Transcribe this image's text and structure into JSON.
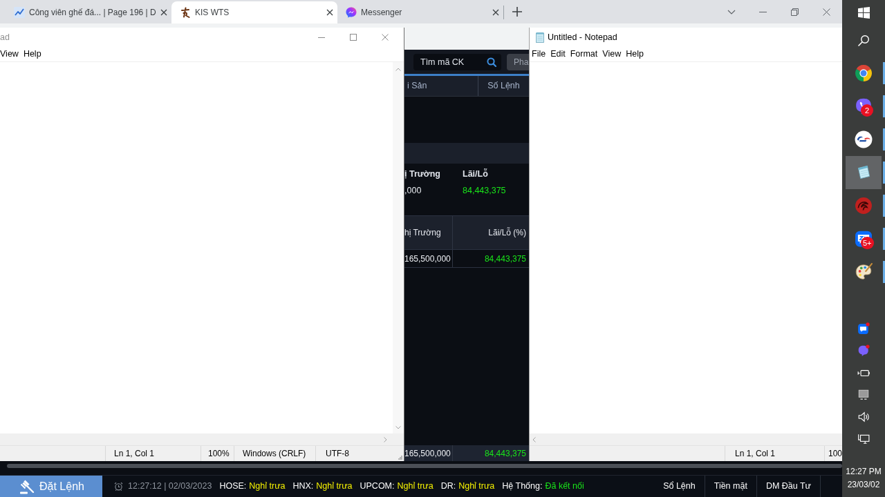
{
  "browser": {
    "tabs": [
      {
        "title": "Công viên ghế đá... | Page 196 | D",
        "selected": false
      },
      {
        "title": "KIS WTS",
        "selected": true
      },
      {
        "title": "Messenger",
        "selected": false
      }
    ]
  },
  "trading_app": {
    "search": {
      "placeholder": "Tìm mã CK"
    },
    "header_button": "Pha",
    "tabs": [
      {
        "label": "i Sản",
        "selected": false
      },
      {
        "label": "Số Lệnh",
        "selected": false
      }
    ],
    "summary": [
      {
        "label": "ị Trường",
        "value": ",000",
        "kind": "plain"
      },
      {
        "label": "Lãi/Lỗ",
        "value": "84,443,375",
        "kind": "gain"
      }
    ],
    "table": {
      "columns": [
        {
          "label": "hị Trường",
          "kind": "plain"
        },
        {
          "label": "Lãi/Lỗ (%)",
          "kind": "gain"
        }
      ],
      "rows": [
        [
          "165,500,000",
          "84,443,375"
        ]
      ],
      "total": [
        "165,500,000",
        "84,443,375"
      ]
    },
    "footer": {
      "order_button": "Đặt Lệnh",
      "clock": "12:27:12 | 02/03/2023",
      "statuses": [
        {
          "label": "HOSE:",
          "value": "Nghỉ trưa",
          "color": "#f7f300"
        },
        {
          "label": "HNX:",
          "value": "Nghỉ trưa",
          "color": "#f7f300"
        },
        {
          "label": "UPCOM:",
          "value": "Nghỉ trưa",
          "color": "#f7f300"
        },
        {
          "label": "DR:",
          "value": "Nghỉ trưa",
          "color": "#f7f300"
        },
        {
          "label": "Hệ Thống:",
          "value": "Đã kết nối",
          "color": "#19e619"
        }
      ],
      "links": [
        "Sổ Lệnh",
        "Tiền mặt",
        "DM Đầu Tư"
      ]
    }
  },
  "notepad_windows": [
    {
      "title": "ad",
      "active": false,
      "menu": [
        "View",
        "Help"
      ],
      "status": [
        "Ln 1, Col 1",
        "100%",
        "Windows (CRLF)",
        "UTF-8"
      ]
    },
    {
      "title": "Untitled - Notepad",
      "active": true,
      "menu": [
        "File",
        "Edit",
        "Format",
        "View",
        "Help"
      ],
      "status": [
        "Ln 1, Col 1",
        "100"
      ]
    }
  ],
  "taskbar": {
    "apps": [
      {
        "kind": "browser",
        "selected": false,
        "running": true
      },
      {
        "kind": "call",
        "badge": "2",
        "selected": false,
        "running": true
      },
      {
        "kind": "round-logo",
        "selected": false,
        "running": true
      },
      {
        "kind": "notepad",
        "selected": true,
        "running": true
      },
      {
        "kind": "swirl-logo",
        "selected": false,
        "running": true
      },
      {
        "kind": "chat",
        "badge": "5+",
        "selected": false,
        "running": true
      },
      {
        "kind": "paint",
        "selected": false,
        "running": true
      }
    ],
    "clock": {
      "time": "12:27 PM",
      "date": "23/03/02"
    }
  }
}
